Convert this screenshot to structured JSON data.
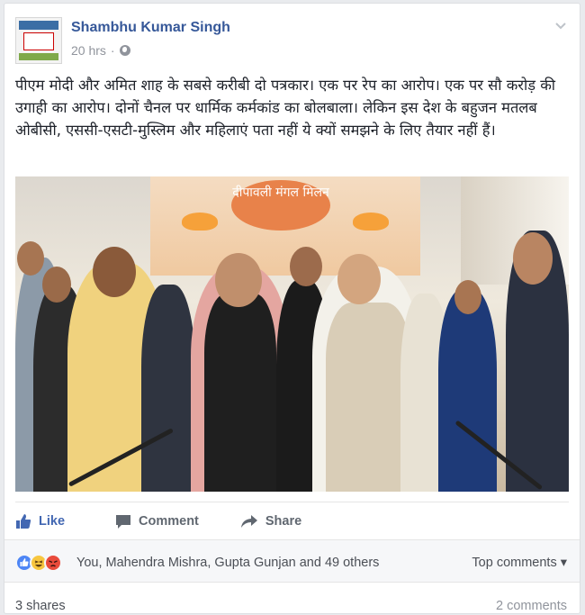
{
  "post": {
    "author": "Shambhu Kumar Singh",
    "time": "20 hrs",
    "separator": "·",
    "text": "पीएम मोदी और अमित शाह के सबसे करीबी दो पत्रकार। एक पर रेप का आरोप। एक पर सौ करोड़ की उगाही का आरोप। दोनों चैनल पर धार्मिक कर्मकांड का बोलबाला। लेकिन इस देश के बहुजन मतलब ओबीसी, एससी-एसटी-मुस्लिम और महिलाएं पता नहीं ये क्यों समझने के लिए तैयार नहीं हैं।",
    "photo_banner_text": "दीपावली मंगल मिलन"
  },
  "actions": {
    "like_label": "Like",
    "comment_label": "Comment",
    "share_label": "Share"
  },
  "reactions": {
    "icons": [
      "like-icon",
      "haha-icon",
      "angry-icon"
    ],
    "summary": "You, Mahendra Mishra, Gupta Gunjan and 49 others",
    "top_comments_label": "Top comments ▾"
  },
  "footer": {
    "shares": "3 shares",
    "comments": "2 comments"
  },
  "colors": {
    "author": "#365899",
    "like": "#4267b2",
    "action_gray": "#606770",
    "meta_gray": "#90949c"
  }
}
